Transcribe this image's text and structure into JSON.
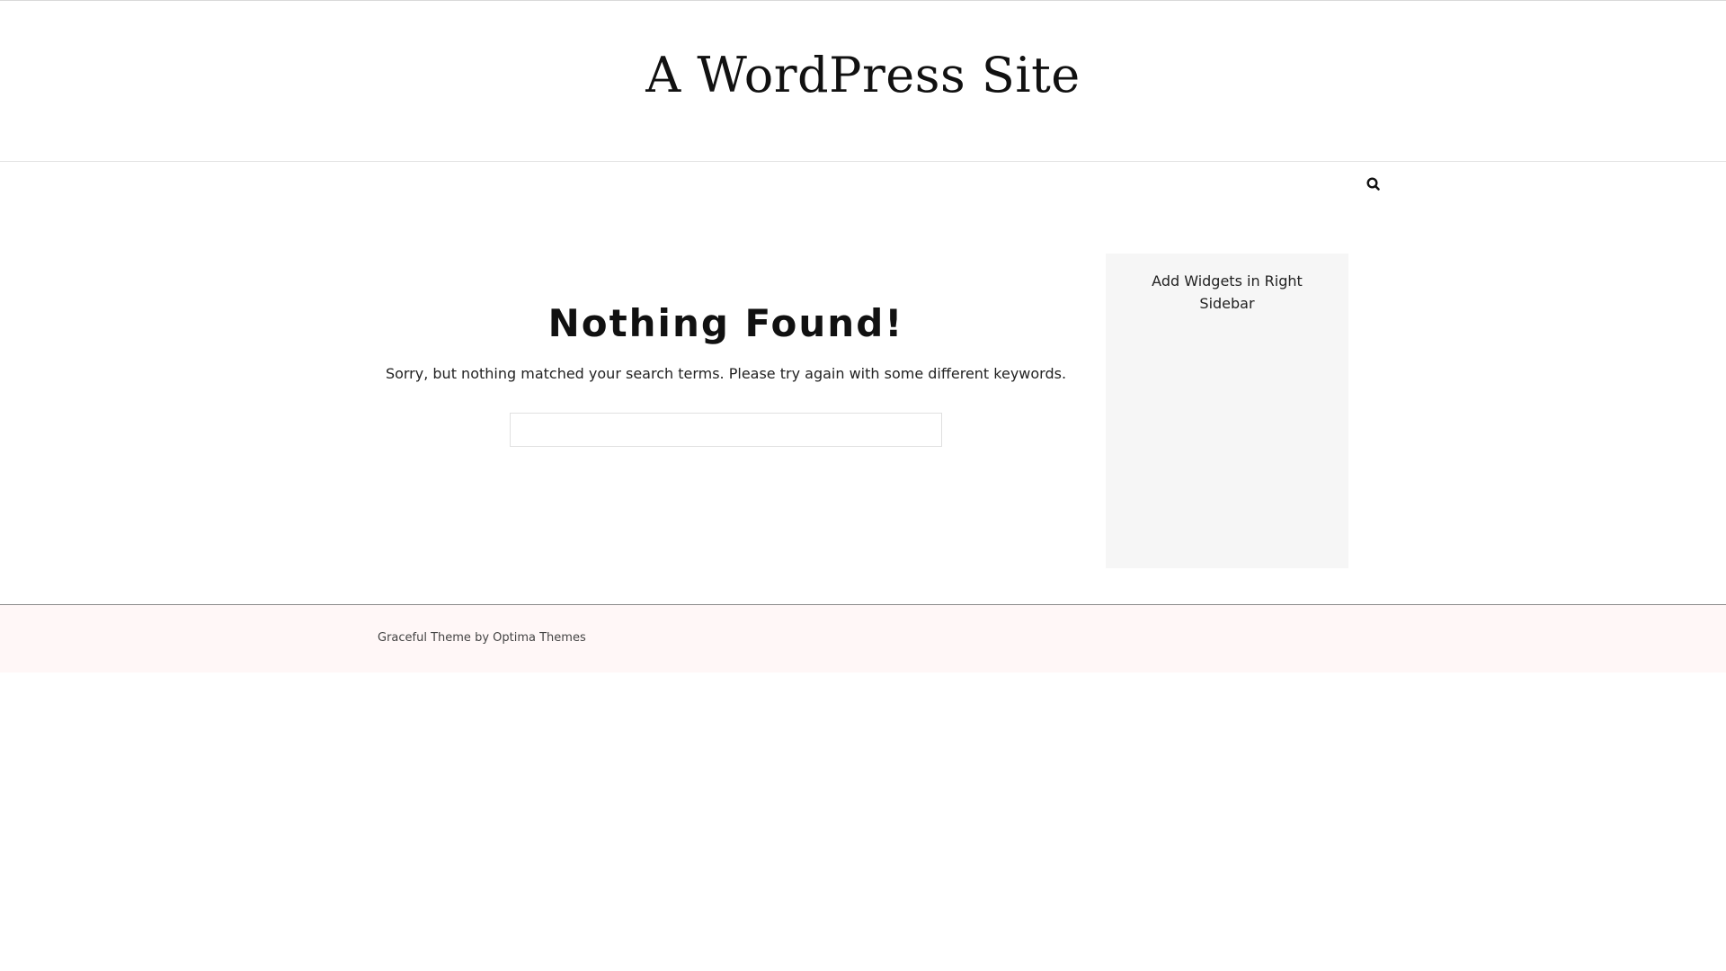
{
  "header": {
    "site_title": "A WordPress Site"
  },
  "nav": {
    "search_icon": "search-icon"
  },
  "main": {
    "page_title": "Nothing Found!",
    "message": "Sorry, but nothing matched your search terms. Please try again with some different keywords.",
    "search_value": "",
    "search_placeholder": ""
  },
  "sidebar": {
    "message": "Add Widgets in Right Sidebar"
  },
  "footer": {
    "theme_name": "Graceful Theme",
    "by_text": " by ",
    "author_name": "Optima Themes"
  },
  "colors": {
    "background": "#ffffff",
    "sidebar_background": "#f6f6f6",
    "footer_background": "#fff7f7",
    "text": "#111111"
  }
}
